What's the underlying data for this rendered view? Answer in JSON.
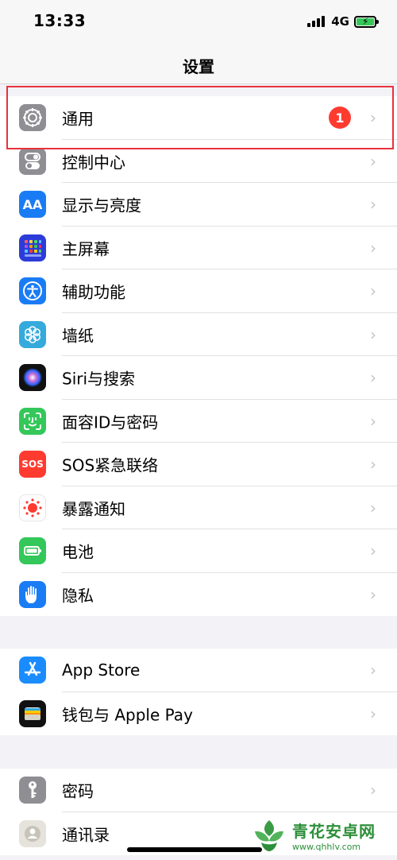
{
  "status": {
    "time": "13:33",
    "network": "4G"
  },
  "nav": {
    "title": "设置"
  },
  "groups": [
    {
      "items": [
        {
          "label": "通用",
          "icon": "gear-icon",
          "badge": "1"
        },
        {
          "label": "控制中心",
          "icon": "toggle-icon"
        },
        {
          "label": "显示与亮度",
          "icon": "text-size-icon",
          "icon_text": "AA"
        },
        {
          "label": "主屏幕",
          "icon": "home-grid-icon"
        },
        {
          "label": "辅助功能",
          "icon": "accessibility-icon"
        },
        {
          "label": "墙纸",
          "icon": "flower-icon"
        },
        {
          "label": "Siri与搜索",
          "icon": "siri-icon"
        },
        {
          "label": "面容ID与密码",
          "icon": "face-id-icon"
        },
        {
          "label": "SOS紧急联络",
          "icon": "sos-icon",
          "icon_text": "SOS"
        },
        {
          "label": "暴露通知",
          "icon": "exposure-icon"
        },
        {
          "label": "电池",
          "icon": "battery-icon"
        },
        {
          "label": "隐私",
          "icon": "hand-icon"
        }
      ]
    },
    {
      "items": [
        {
          "label": "App Store",
          "icon": "app-store-icon"
        },
        {
          "label": "钱包与 Apple Pay",
          "icon": "wallet-icon"
        }
      ]
    },
    {
      "items": [
        {
          "label": "密码",
          "icon": "key-icon"
        },
        {
          "label": "通讯录",
          "icon": "contacts-icon"
        }
      ]
    }
  ],
  "watermark": {
    "title": "青花安卓网",
    "url": "www.qhhlv.com"
  },
  "colors": {
    "accent_red": "#ff3b30",
    "highlight": "#e8323c",
    "gray_icon": "#8e8e93",
    "blue_icon": "#1a7cf5",
    "green_icon": "#34c759"
  }
}
